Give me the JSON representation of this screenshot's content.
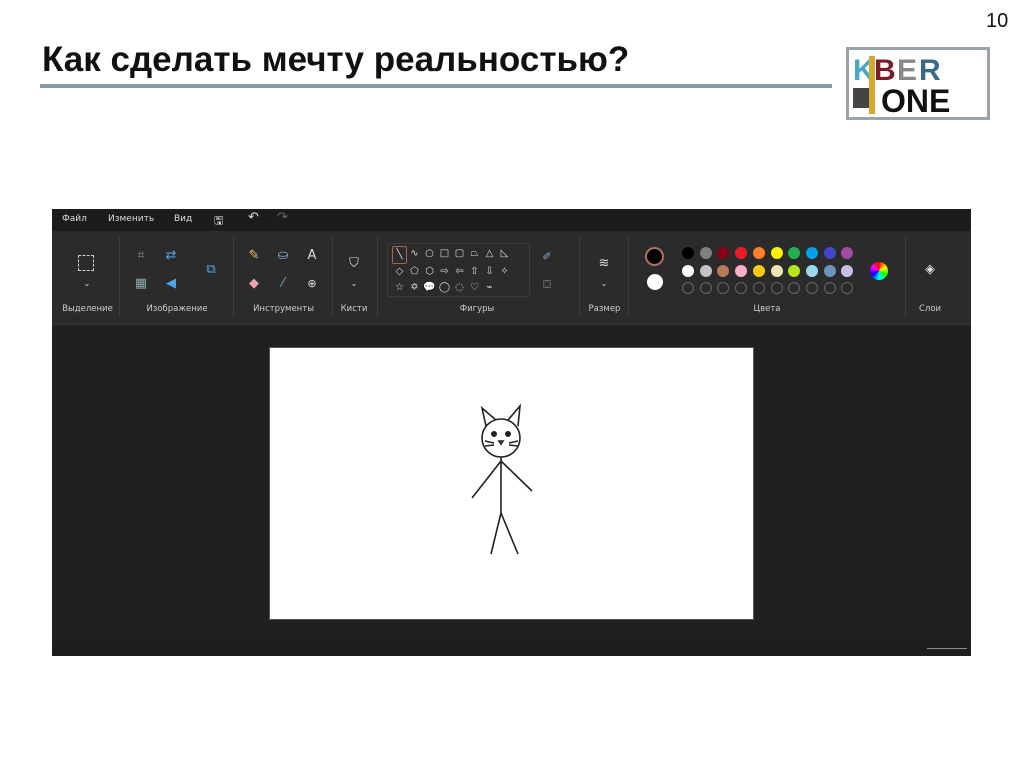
{
  "slide": {
    "title": "Как сделать мечту реальностью?",
    "page_number": "10",
    "logo_text": "KIBER ONE"
  },
  "paint": {
    "menu": [
      "Файл",
      "Изменить",
      "Вид"
    ],
    "groups": {
      "selection": "Выделение",
      "image": "Изображение",
      "tools": "Инструменты",
      "brushes": "Кисти",
      "shapes": "Фигуры",
      "size": "Размер",
      "colors": "Цвета",
      "layers": "Слои"
    },
    "shapes": [
      "╲",
      "∿",
      "○",
      "□",
      "▢",
      "⏢",
      "△",
      "◺",
      "◇",
      "⬠",
      "⬡",
      "⇨",
      "⇦",
      "⇧",
      "⇩",
      "✧",
      "☆",
      "✡",
      "💬",
      "◯",
      "◌",
      "♡",
      "⌁"
    ],
    "primary_color": "#000000",
    "secondary_color": "#ffffff",
    "palette": [
      "#000000",
      "#7f7f7f",
      "#880015",
      "#ed1c24",
      "#ff7f27",
      "#fff200",
      "#22b14c",
      "#00a2e8",
      "#3f48cc",
      "#a349a4",
      "#ffffff",
      "#c3c3c3",
      "#b97a57",
      "#ffaec9",
      "#ffc90e",
      "#efe4b0",
      "#b5e61d",
      "#99d9ea",
      "#7092be",
      "#c8bfe7"
    ]
  }
}
